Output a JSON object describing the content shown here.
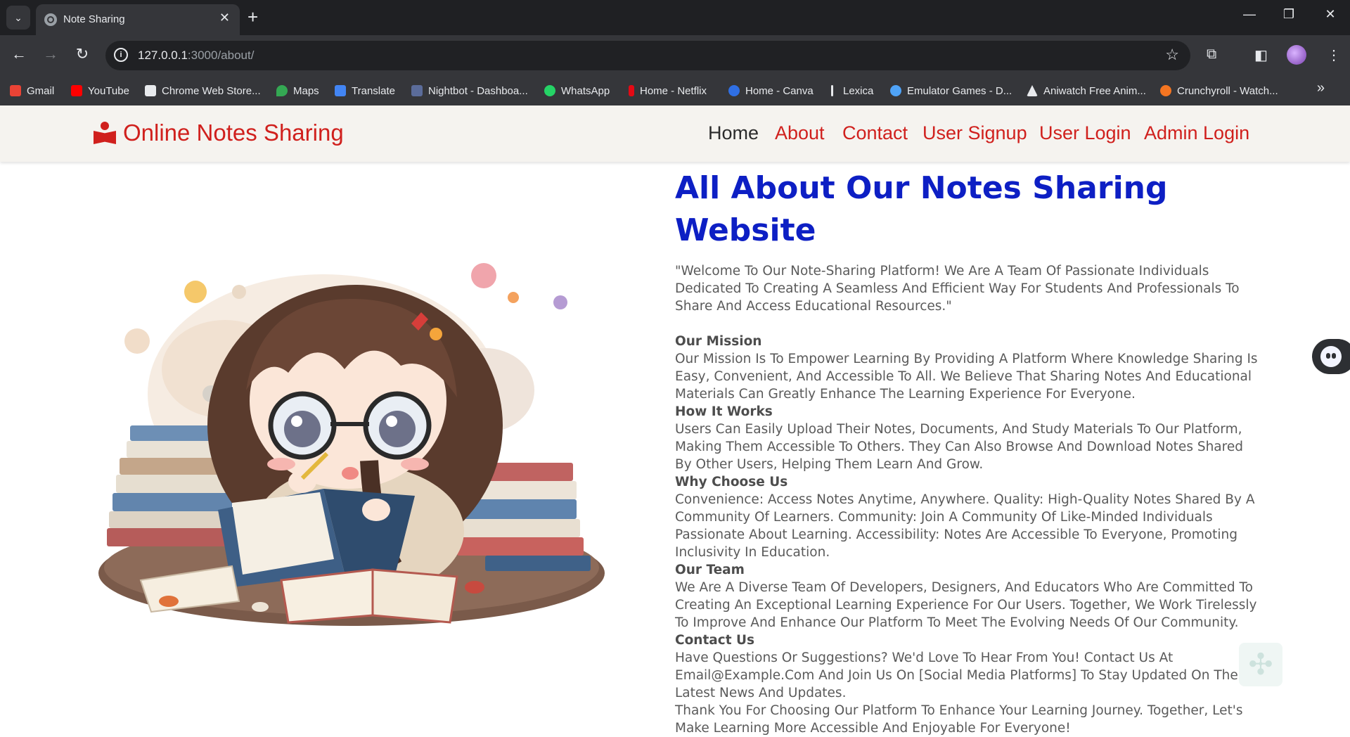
{
  "browser": {
    "tab_title": "Note Sharing",
    "url_host": "127.0.0.1",
    "url_rest": ":3000/about/",
    "bookmarks": [
      {
        "label": "Gmail",
        "icon": "gmail-icon",
        "color": "#ea4335"
      },
      {
        "label": "YouTube",
        "icon": "youtube-icon",
        "color": "#ff0000"
      },
      {
        "label": "Chrome Web Store...",
        "icon": "chrome-web-store-icon",
        "color": "#e8eaed"
      },
      {
        "label": "Maps",
        "icon": "maps-icon",
        "color": "#34a853"
      },
      {
        "label": "Translate",
        "icon": "translate-icon",
        "color": "#4285f4"
      },
      {
        "label": "Nightbot - Dashboa...",
        "icon": "nightbot-icon",
        "color": "#5b6c9a"
      },
      {
        "label": "WhatsApp",
        "icon": "whatsapp-icon",
        "color": "#25d366"
      },
      {
        "label": "Home - Netflix",
        "icon": "netflix-icon",
        "color": "#e50914"
      },
      {
        "label": "Home - Canva",
        "icon": "canva-icon",
        "color": "#2f6fe4"
      },
      {
        "label": "Lexica",
        "icon": "lexica-icon",
        "color": "#e8eaed"
      },
      {
        "label": "Emulator Games - D...",
        "icon": "emulator-games-icon",
        "color": "#4fa3f7"
      },
      {
        "label": "Aniwatch Free Anim...",
        "icon": "aniwatch-icon",
        "color": "#e8eaed"
      },
      {
        "label": "Crunchyroll - Watch...",
        "icon": "crunchyroll-icon",
        "color": "#f47521"
      }
    ]
  },
  "site": {
    "brand": "Online Notes Sharing",
    "nav": [
      "Home",
      "About",
      "Contact",
      "User Signup",
      "User Login",
      "Admin Login"
    ],
    "accent_color": "#d0201d",
    "title_color": "#0d1fc4"
  },
  "about": {
    "heading": "All About Our Notes Sharing Website",
    "intro": "\"Welcome To Our Note-Sharing Platform! We Are A Team Of Passionate Individuals Dedicated To Creating A Seamless And Efficient Way For Students And Professionals To Share And Access Educational Resources.\"",
    "sections": [
      {
        "title": "Our Mission",
        "body": "Our Mission Is To Empower Learning By Providing A Platform Where Knowledge Sharing Is Easy, Convenient, And Accessible To All. We Believe That Sharing Notes And Educational Materials Can Greatly Enhance The Learning Experience For Everyone."
      },
      {
        "title": "How It Works",
        "body": "Users Can Easily Upload Their Notes, Documents, And Study Materials To Our Platform, Making Them Accessible To Others. They Can Also Browse And Download Notes Shared By Other Users, Helping Them Learn And Grow."
      },
      {
        "title": "Why Choose Us",
        "body": "Convenience: Access Notes Anytime, Anywhere. Quality: High-Quality Notes Shared By A Community Of Learners. Community: Join A Community Of Like-Minded Individuals Passionate About Learning. Accessibility: Notes Are Accessible To Everyone, Promoting Inclusivity In Education."
      },
      {
        "title": "Our Team",
        "body": "We Are A Diverse Team Of Developers, Designers, And Educators Who Are Committed To Creating An Exceptional Learning Experience For Our Users. Together, We Work Tirelessly To Improve And Enhance Our Platform To Meet The Evolving Needs Of Our Community."
      },
      {
        "title": "Contact Us",
        "body": "Have Questions Or Suggestions? We'd Love To Hear From You! Contact Us At Email@Example.Com And Join Us On [Social Media Platforms] To Stay Updated On The Latest News And Updates."
      }
    ],
    "closing": "Thank You For Choosing Our Platform To Enhance Your Learning Journey. Together, Let's Make Learning More Accessible And Enjoyable For Everyone!"
  }
}
